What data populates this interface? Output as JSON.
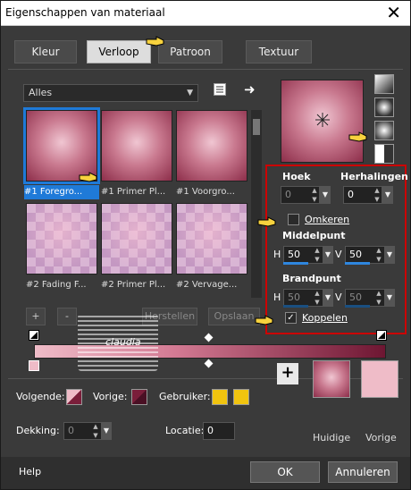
{
  "window": {
    "title": "Eigenschappen van materiaal",
    "close_label": "✕"
  },
  "tabs": [
    {
      "label": "Kleur",
      "active": false
    },
    {
      "label": "Verloop",
      "active": true
    },
    {
      "label": "Patroon",
      "active": false
    },
    {
      "label": "Textuur",
      "active": false
    }
  ],
  "library": {
    "filter_value": "Alles",
    "tiles": [
      {
        "label": "#1 Foregro...",
        "style": "gradient",
        "selected": true
      },
      {
        "label": "#1 Primer Pl...",
        "style": "gradient",
        "selected": false
      },
      {
        "label": "#1 Voorgro...",
        "style": "gradient",
        "selected": false
      },
      {
        "label": "#2 Fading F...",
        "style": "checker",
        "selected": false
      },
      {
        "label": "#2 Primer Pl...",
        "style": "checker",
        "selected": false
      },
      {
        "label": "#2 Vervage...",
        "style": "checker",
        "selected": false
      }
    ],
    "add_label": "+",
    "remove_label": "-",
    "restore_label": "Herstellen",
    "save_label": "Opslaan"
  },
  "settings": {
    "angle_label": "Hoek",
    "angle_value": "0",
    "repeats_label": "Herhalingen",
    "repeats_value": "0",
    "invert_label": "Omkeren",
    "invert_checked": false,
    "center_label": "Middelpunt",
    "center_h_label": "H",
    "center_h_value": "50",
    "center_v_label": "V",
    "center_v_value": "50",
    "focal_label": "Brandpunt",
    "focal_h_label": "H",
    "focal_h_value": "50",
    "focal_v_label": "V",
    "focal_v_value": "50",
    "link_label": "Koppelen",
    "link_checked": true,
    "check_mark": "✓"
  },
  "colors": {
    "foreground_label": "Volgende:",
    "background_label": "Vorige:",
    "user_label": "Gebruiker:",
    "user_color": "#f1c40f",
    "opacity_label": "Dekking:",
    "opacity_value": "0",
    "location_label": "Locatie:",
    "location_value": "0",
    "current_label": "Huidige",
    "previous_label": "Vorige",
    "previous_color": "#efbcc8",
    "accent": "#1f7ad8",
    "highlight_border": "#cc0000"
  },
  "footer": {
    "help_label": "Help",
    "ok_label": "OK",
    "cancel_label": "Annuleren"
  },
  "watermark": {
    "text": "claudia"
  }
}
